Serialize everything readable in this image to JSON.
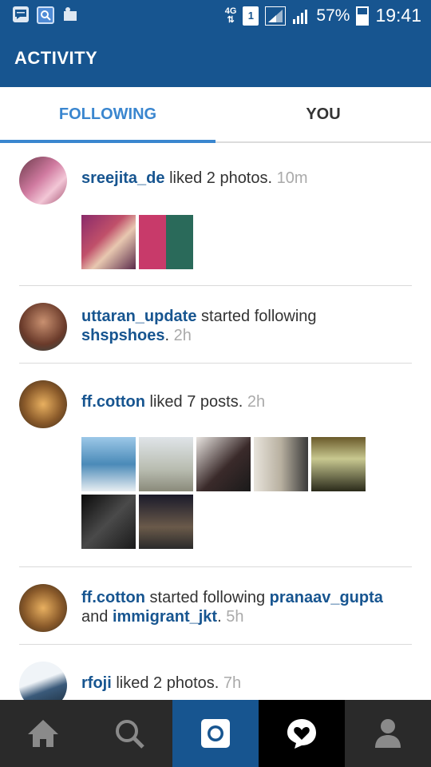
{
  "status_bar": {
    "network": "4G",
    "sim_slot": "1",
    "battery_percent": "57%",
    "time": "19:41",
    "icons": [
      "message-icon",
      "search-app-icon",
      "photo-app-icon"
    ]
  },
  "header": {
    "title": "ACTIVITY"
  },
  "tabs": [
    {
      "label": "FOLLOWING",
      "active": true
    },
    {
      "label": "YOU",
      "active": false
    }
  ],
  "feed": [
    {
      "user": "sreejita_de",
      "action": " liked 2 photos. ",
      "time": "10m",
      "thumbnails": 2
    },
    {
      "user": "uttaran_update",
      "action": " started following ",
      "target": "shspshoes",
      "sep": ". ",
      "time": "2h"
    },
    {
      "user": "ff.cotton",
      "action": " liked 7 posts. ",
      "time": "2h",
      "thumbnails": 7
    },
    {
      "user": "ff.cotton",
      "action": " started following ",
      "target": "pranaav_gupta",
      "and": "and ",
      "target2": "immigrant_jkt",
      "sep": ". ",
      "time": "5h"
    },
    {
      "user": "rfoji",
      "action": " liked 2 photos. ",
      "time": "7h"
    }
  ],
  "bottom_nav": [
    {
      "icon": "home-icon",
      "label": "Home"
    },
    {
      "icon": "search-icon",
      "label": "Explore"
    },
    {
      "icon": "camera-icon",
      "label": "Camera"
    },
    {
      "icon": "activity-heart-icon",
      "label": "Activity"
    },
    {
      "icon": "profile-icon",
      "label": "Profile"
    }
  ],
  "colors": {
    "primary": "#175590",
    "accent": "#3a86cf",
    "nav_bg": "#2a2a2a"
  }
}
